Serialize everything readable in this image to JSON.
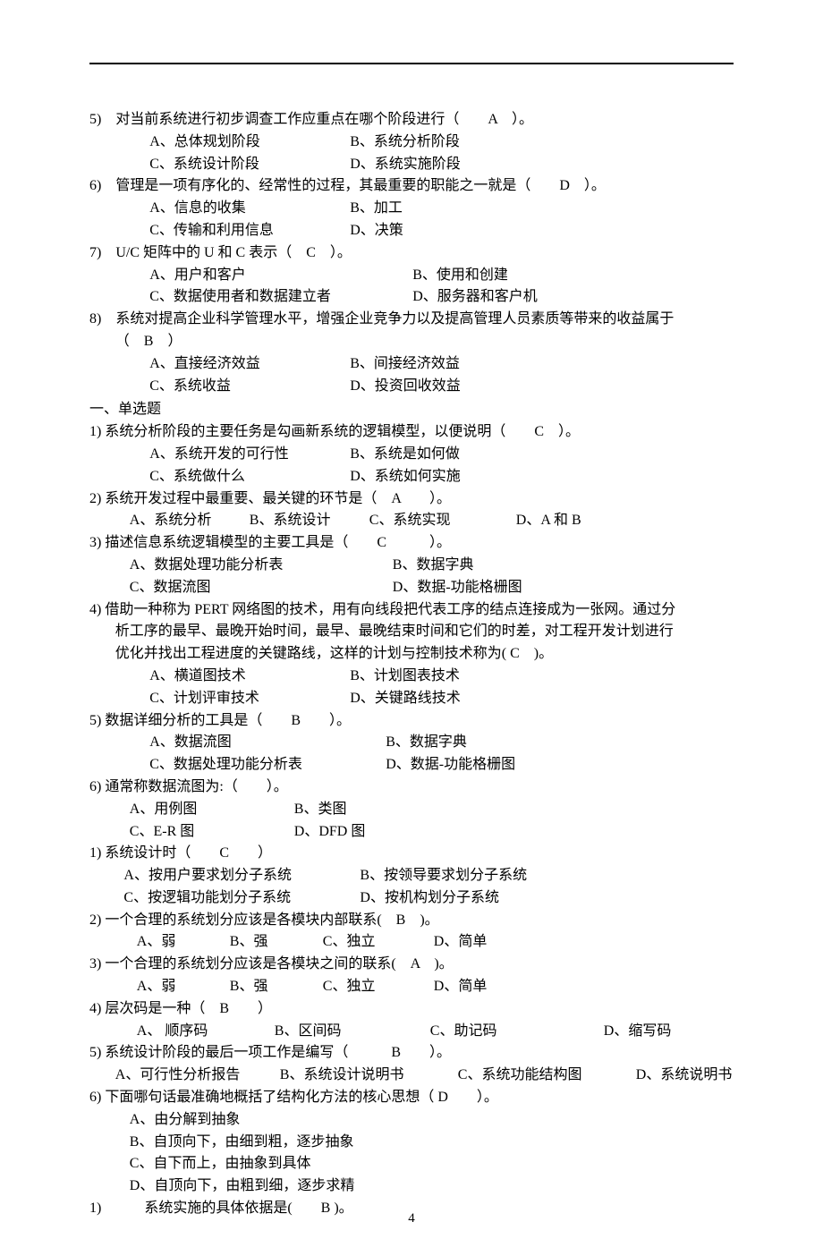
{
  "page_number": "4",
  "block1": {
    "q5": {
      "text": "5)　对当前系统进行初步调查工作应重点在哪个阶段进行（　　A　）。",
      "a": "A、总体规划阶段",
      "b": "B、系统分析阶段",
      "c": "C、系统设计阶段",
      "d": "D、系统实施阶段"
    },
    "q6": {
      "text": "6)　管理是一项有序化的、经常性的过程，其最重要的职能之一就是（　　D　）。",
      "a": "A、信息的收集",
      "b": "B、加工",
      "c": "C、传输和利用信息",
      "d": "D、决策"
    },
    "q7": {
      "text": "7)　U/C 矩阵中的 U 和 C 表示（　C　）。",
      "a": "A、用户和客户",
      "b": "B、使用和创建",
      "c": "C、数据使用者和数据建立者",
      "d": "D、服务器和客户机"
    },
    "q8": {
      "text1": "8)　系统对提高企业科学管理水平，增强企业竞争力以及提高管理人员素质等带来的收益属于",
      "text2": "（　B　）",
      "a": "A、直接经济效益",
      "b": "B、间接经济效益",
      "c": "C、系统收益",
      "d": "D、投资回收效益"
    }
  },
  "heading1": "一、单选题",
  "block2": {
    "q1": {
      "text": "1) 系统分析阶段的主要任务是勾画新系统的逻辑模型，以便说明（　　C　）。",
      "a": "A、系统开发的可行性",
      "b": "B、系统是如何做",
      "c": "C、系统做什么",
      "d": "D、系统如何实施"
    },
    "q2": {
      "text": "2) 系统开发过程中最重要、最关键的环节是（　A　　）。",
      "a": "A、系统分析",
      "b": "B、系统设计",
      "c": "C、系统实现",
      "d": "D、A 和 B"
    },
    "q3": {
      "text": "3) 描述信息系统逻辑模型的主要工具是（　　C　　　）。",
      "a": "A、数据处理功能分析表",
      "b": "B、数据字典",
      "c": "C、数据流图",
      "d": "D、数据-功能格栅图"
    },
    "q4": {
      "text1": "4) 借助一种称为 PERT 网络图的技术，用有向线段把代表工序的结点连接成为一张网。通过分",
      "text2": "析工序的最早、最晚开始时间，最早、最晚结束时间和它们的时差，对工程开发计划进行",
      "text3": "优化并找出工程进度的关键路线，这样的计划与控制技术称为( C　)。",
      "a": "A、横道图技术",
      "b": "B、计划图表技术",
      "c": "C、计划评审技术",
      "d": "D、关键路线技术"
    },
    "q5": {
      "text": "5) 数据详细分析的工具是（　　B　　）。",
      "a": "A、数据流图",
      "b": "B、数据字典",
      "c": "C、数据处理功能分析表",
      "d": "D、数据-功能格栅图"
    },
    "q6": {
      "text": "6) 通常称数据流图为:（　　）。",
      "a": "A、用例图",
      "b": "B、类图",
      "c": "C、E-R 图",
      "d": "D、DFD 图"
    }
  },
  "block3": {
    "q1": {
      "text": "1) 系统设计时（　　C　　）",
      "a": "A、按用户要求划分子系统",
      "b": "B、按领导要求划分子系统",
      "c": "C、按逻辑功能划分子系统",
      "d": "D、按机构划分子系统"
    },
    "q2": {
      "text": "2) 一个合理的系统划分应该是各模块内部联系(　B　)。",
      "a": "A、弱",
      "b": "B、强",
      "c": "C、独立",
      "d": "D、简单"
    },
    "q3": {
      "text": "3) 一个合理的系统划分应该是各模块之间的联系(　A　)。",
      "a": "A、弱",
      "b": "B、强",
      "c": "C、独立",
      "d": "D、简单"
    },
    "q4": {
      "text": "4) 层次码是一种（　B　　）",
      "a": "A、 顺序码",
      "b": "B、区间码",
      "c": "C、助记码",
      "d": "D、缩写码"
    },
    "q5": {
      "text": "5) 系统设计阶段的最后一项工作是编写（　　　B　　）。",
      "a": "A、可行性分析报告",
      "b": "B、系统设计说明书",
      "c": "C、系统功能结构图",
      "d": "D、系统说明书"
    },
    "q6": {
      "text": "6) 下面哪句话最准确地概括了结构化方法的核心思想（ D　　）。",
      "a": "A、由分解到抽象",
      "b": "B、自顶向下，由细到粗，逐步抽象",
      "c": "C、自下而上，由抽象到具体",
      "d": "D、自顶向下，由粗到细，逐步求精"
    }
  },
  "block4": {
    "q1": {
      "text": "1)　　　系统实施的具体依据是(　　B )。"
    }
  }
}
